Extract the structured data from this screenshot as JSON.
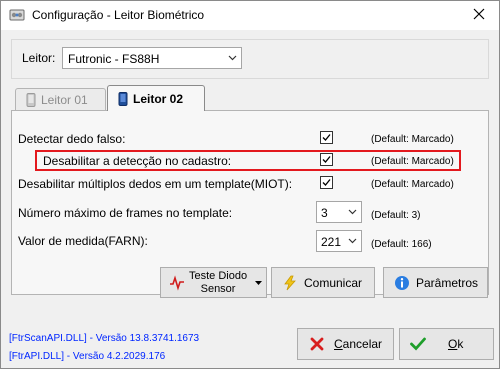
{
  "window": {
    "title": "Configuração - Leitor Biométrico"
  },
  "reader": {
    "label": "Leitor:",
    "selected": "Futronic - FS88H"
  },
  "tabs": [
    {
      "label": "Leitor 01",
      "active": false
    },
    {
      "label": "Leitor 02",
      "active": true
    }
  ],
  "options": [
    {
      "label": "Detectar dedo falso:",
      "checked": true,
      "default": "(Default: Marcado)"
    },
    {
      "label": "Desabilitar a detecção no cadastro:",
      "checked": true,
      "default": "(Default: Marcado)"
    },
    {
      "label": "Desabilitar múltiplos dedos em um template(MIOT):",
      "checked": true,
      "default": "(Default: Marcado)"
    }
  ],
  "frames": {
    "label": "Número máximo de frames no template:",
    "value": "3",
    "default": "(Default: 3)"
  },
  "farn": {
    "label": "Valor de medida(FARN):",
    "value": "221",
    "default": "(Default: 166)"
  },
  "buttons": {
    "test_line1": "Teste Diodo",
    "test_line2": "Sensor",
    "communicate": "Comunicar",
    "parameters": "Parâmetros",
    "cancel_prefix": "C",
    "cancel_rest": "ancelar",
    "ok_prefix": "O",
    "ok_rest": "k"
  },
  "dll_versions": [
    "[FtrScanAPI.DLL] - Versão 13.8.3741.1673",
    "[FtrAPI.DLL] - Versão 4.2.2029.176"
  ],
  "colors": {
    "highlight": "#e3191e",
    "dll_text": "#0026ff"
  }
}
